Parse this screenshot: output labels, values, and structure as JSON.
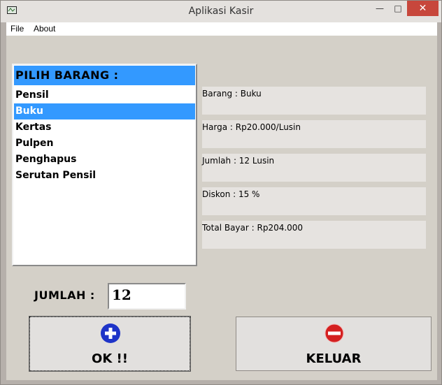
{
  "window": {
    "title": "Aplikasi Kasir"
  },
  "controls": {
    "minimize": "—",
    "maximize": "□",
    "close": "✕"
  },
  "menu": [
    {
      "label": "File"
    },
    {
      "label": "About"
    }
  ],
  "product_list": {
    "header": "PILIH BARANG :",
    "items": [
      {
        "label": "Pensil"
      },
      {
        "label": "Buku"
      },
      {
        "label": "Kertas"
      },
      {
        "label": "Pulpen"
      },
      {
        "label": "Penghapus"
      },
      {
        "label": "Serutan Pensil"
      }
    ],
    "selected": "Buku"
  },
  "info": {
    "item": "Barang : Buku",
    "price": "Harga : Rp20.000/Lusin",
    "quantity": "Jumlah : 12 Lusin",
    "discount": "Diskon : 15 %",
    "total": "Total Bayar : Rp204.000"
  },
  "quantity": {
    "label": "JUMLAH  :",
    "value": "12"
  },
  "buttons": {
    "ok": {
      "label": "OK !!",
      "icon": "plus-circle-icon",
      "color": "#1e34c8"
    },
    "exit": {
      "label": "KELUAR",
      "icon": "minus-circle-icon",
      "color": "#d42020"
    }
  },
  "colors": {
    "selection": "#3399ff",
    "window_bg": "#d4d0c8"
  }
}
